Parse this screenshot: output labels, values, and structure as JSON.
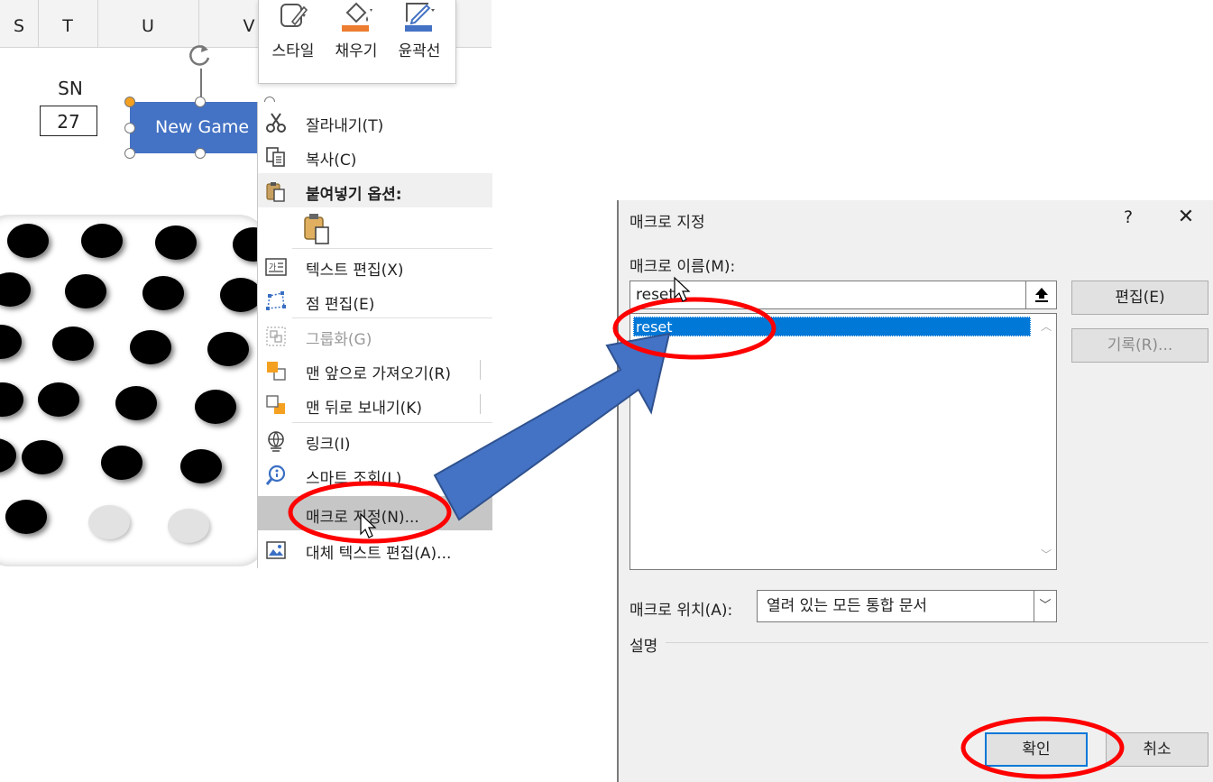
{
  "spreadsheet": {
    "columns": [
      "S",
      "T",
      "U",
      "V"
    ],
    "sn_label": "SN",
    "sn_value": "27",
    "shape_label": "New Game"
  },
  "mini_toolbar": {
    "items": [
      {
        "label": "스타일",
        "icon": "shape-style-icon"
      },
      {
        "label": "채우기",
        "icon": "fill-bucket-icon"
      },
      {
        "label": "윤곽선",
        "icon": "outline-pen-icon"
      }
    ],
    "colors": {
      "fill": "#ed7d31",
      "outline": "#4472c4"
    }
  },
  "context_menu": {
    "items": [
      {
        "label": "잘라내기(T)",
        "icon": "scissors-icon",
        "state": "normal"
      },
      {
        "label": "복사(C)",
        "icon": "copy-icon",
        "state": "normal"
      },
      {
        "label": "붙여넣기 옵션:",
        "icon": "paste-icon",
        "state": "header"
      },
      {
        "label": "텍스트 편집(X)",
        "icon": "edit-text-icon",
        "state": "normal"
      },
      {
        "label": "점 편집(E)",
        "icon": "edit-points-icon",
        "state": "normal"
      },
      {
        "label": "그룹화(G)",
        "icon": "group-icon",
        "state": "disabled"
      },
      {
        "label": "맨 앞으로 가져오기(R)",
        "icon": "bring-to-front-icon",
        "state": "normal"
      },
      {
        "label": "맨 뒤로 보내기(K)",
        "icon": "send-to-back-icon",
        "state": "normal"
      },
      {
        "label": "링크(I)",
        "icon": "link-icon",
        "state": "normal"
      },
      {
        "label": "스마트 조회(L)",
        "icon": "smart-lookup-icon",
        "state": "normal"
      },
      {
        "label": "매크로 지정(N)...",
        "icon": "",
        "state": "selected"
      },
      {
        "label": "대체 텍스트 편집(A)...",
        "icon": "alt-text-icon",
        "state": "normal"
      }
    ]
  },
  "dialog": {
    "title": "매크로 지정",
    "help": "?",
    "close": "✕",
    "name_label": "매크로 이름(M):",
    "name_value": "reset",
    "list_items": [
      "reset"
    ],
    "edit_button": "편집(E)",
    "record_button": "기록(R)...",
    "location_label": "매크로 위치(A):",
    "location_value": "열려 있는 모든 통합 문서",
    "description_label": "설명",
    "ok_button": "확인",
    "cancel_button": "취소"
  },
  "annotations": {
    "highlight_color": "#ff0000",
    "arrow_color": "#4472c4"
  }
}
